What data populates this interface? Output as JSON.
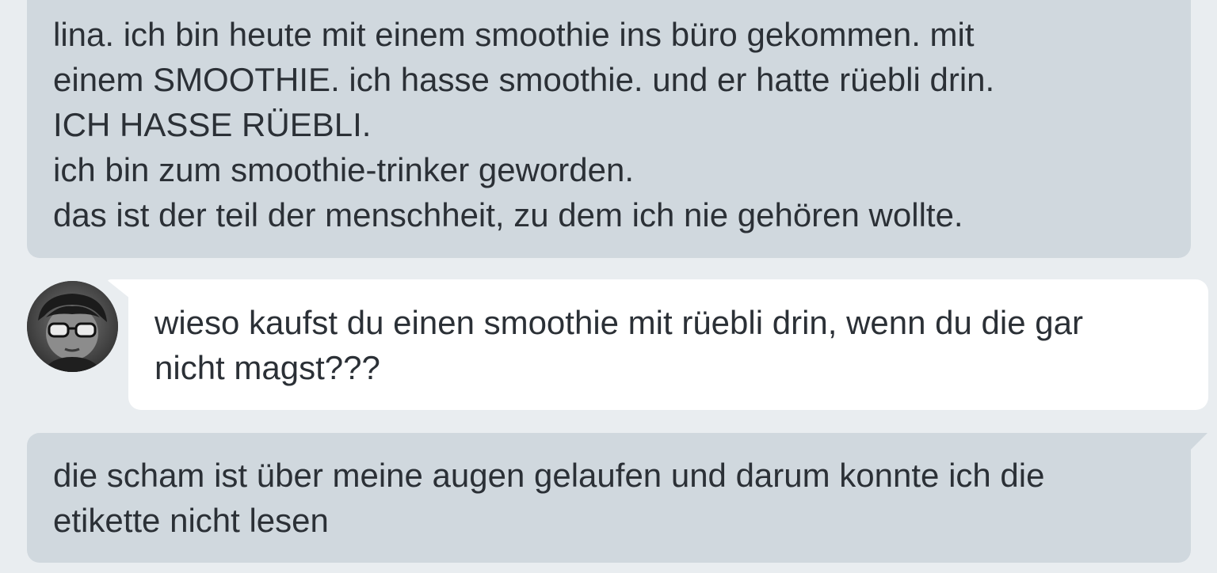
{
  "conversation": {
    "messages": [
      {
        "sender": "other",
        "lines": [
          "lina. ich bin heute mit einem smoothie ins büro gekommen. mit",
          "einem SMOOTHIE. ich hasse smoothie. und er hatte rüebli drin.",
          "ICH HASSE RÜEBLI.",
          "ich bin zum smoothie-trinker geworden.",
          "das ist der teil der menschheit, zu dem ich nie gehören wollte."
        ]
      },
      {
        "sender": "self",
        "avatar_icon": "user-avatar-sunglasses-icon",
        "lines": [
          "wieso kaufst du einen smoothie mit rüebli drin, wenn du die gar",
          "nicht magst???"
        ]
      },
      {
        "sender": "other",
        "lines": [
          "die scham ist über meine augen gelaufen und darum konnte ich die",
          "etikette nicht lesen"
        ]
      }
    ]
  },
  "colors": {
    "background": "#e9edf0",
    "grey_bubble": "#d0d8de",
    "white_bubble": "#ffffff",
    "text": "#2b3036"
  }
}
